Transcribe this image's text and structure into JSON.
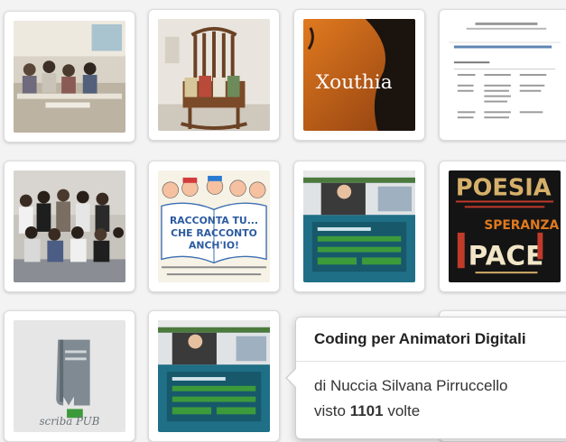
{
  "tiles": [
    {
      "name": "classroom-photo",
      "title": ""
    },
    {
      "name": "books-chair-photo",
      "title": ""
    },
    {
      "name": "xouthia-cover",
      "title": "Xouthia"
    },
    {
      "name": "document-screenshot",
      "title": ""
    },
    {
      "name": "students-group-photo",
      "title": ""
    },
    {
      "name": "racconta-drawing",
      "title": "RACCONTA TU... CHE RACCONTO ANCH'IO!"
    },
    {
      "name": "coding-course-screenshot",
      "title": ""
    },
    {
      "name": "poesia-speranza-pace",
      "title": "POESIA SPERANZA PACE"
    },
    {
      "name": "scriba-pub-cover",
      "title": "scriba PUB"
    },
    {
      "name": "coding-course-screenshot-2",
      "title": ""
    }
  ],
  "popover": {
    "title": "Coding per Animatori Digitali",
    "author_line": "di Nuccia Silvana Pirruccello",
    "views_prefix": "visto",
    "views_count": "1101",
    "views_suffix": "volte"
  },
  "colors": {
    "accent_green": "#3d9a3b",
    "screen_blue": "#1f6f86",
    "poster_red": "#c23b2a"
  }
}
